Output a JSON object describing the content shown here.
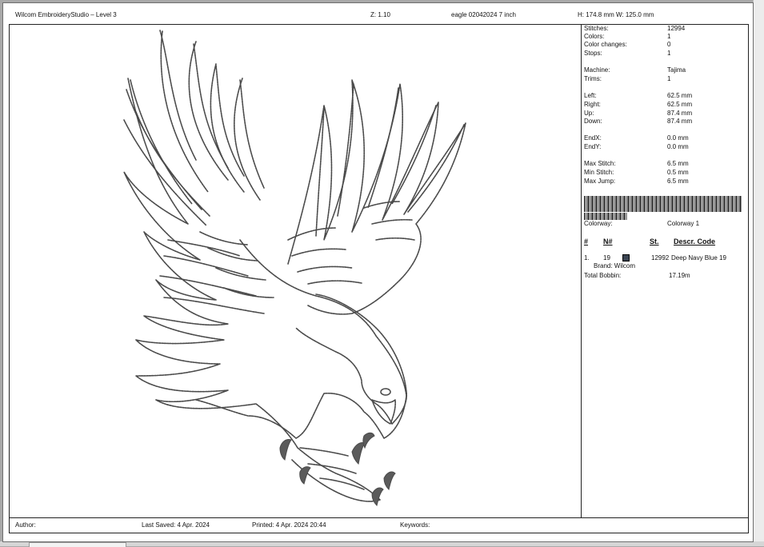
{
  "header": {
    "app_title": "Wilcom EmbroideryStudio – Level 3",
    "zoom": "Z: 1.10",
    "file_name": "eagle 02042024 7 inch",
    "height": "H: 174.8 mm",
    "width": "W: 125.0 mm"
  },
  "stats": {
    "stitches_label": "Stitches:",
    "stitches": "12994",
    "colors_label": "Colors:",
    "colors": "1",
    "color_changes_label": "Color changes:",
    "color_changes": "0",
    "stops_label": "Stops:",
    "stops": "1",
    "machine_label": "Machine:",
    "machine": "Tajima",
    "trims_label": "Trims:",
    "trims": "1",
    "left_label": "Left:",
    "left": "62.5 mm",
    "right_label": "Right:",
    "right": "62.5 mm",
    "up_label": "Up:",
    "up": "87.4 mm",
    "down_label": "Down:",
    "down": "87.4 mm",
    "endx_label": "EndX:",
    "endx": "0.0 mm",
    "endy_label": "EndY:",
    "endy": "0.0 mm",
    "max_stitch_label": "Max Stitch:",
    "max_stitch": "6.5 mm",
    "min_stitch_label": "Min Stitch:",
    "min_stitch": "0.5 mm",
    "max_jump_label": "Max Jump:",
    "max_jump": "6.5 mm"
  },
  "colorway": {
    "label": "Colorway:",
    "value": "Colorway 1"
  },
  "thread_table": {
    "headers": {
      "index": "#",
      "number": "N#",
      "stitches": "St.",
      "descr_code": "Descr. Code"
    },
    "rows": [
      {
        "index": "1.",
        "number": "19",
        "swatch_color": "#3a4452",
        "stitches": "12992",
        "description": "Deep Navy Blue 19",
        "brand": "Brand: Wilcom"
      }
    ],
    "total_bobbin_label": "Total Bobbin:",
    "total_bobbin": "17.19m"
  },
  "footer": {
    "author": "Author:",
    "last_saved": "Last Saved:  4 Apr. 2024",
    "printed": "Printed:  4 Apr. 2024 20:44",
    "keywords": "Keywords:"
  },
  "colors": {
    "stitch_line": "#4a4a4a",
    "talon": "#5b5b5b",
    "background": "#a9a9a9"
  }
}
